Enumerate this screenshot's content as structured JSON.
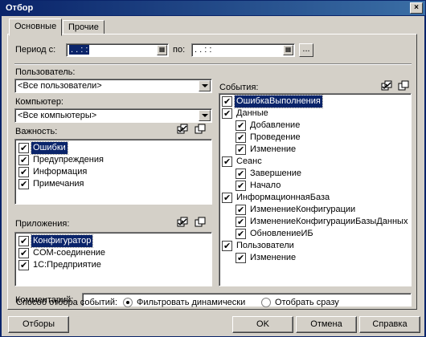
{
  "window": {
    "title": "Отбор",
    "close": "×"
  },
  "tabs": [
    {
      "label": "Основные"
    },
    {
      "label": "Прочие"
    }
  ],
  "period": {
    "label_from": "Период с:",
    "value_from": "  .  .    :  :",
    "label_to": "по:",
    "value_to": "  .  .    :  :",
    "more_button": "..."
  },
  "user": {
    "label": "Пользователь:",
    "value": "<Все пользователи>"
  },
  "computer": {
    "label": "Компьютер:",
    "value": "<Все компьютеры>"
  },
  "importance": {
    "label": "Важность:",
    "items": [
      {
        "label": "Ошибки",
        "checked": true,
        "selected": true
      },
      {
        "label": "Предупреждения",
        "checked": true
      },
      {
        "label": "Информация",
        "checked": true
      },
      {
        "label": "Примечания",
        "checked": true
      }
    ]
  },
  "applications": {
    "label": "Приложения:",
    "items": [
      {
        "label": "Конфигуратор",
        "checked": true,
        "selected": true
      },
      {
        "label": "COM-соединение",
        "checked": true
      },
      {
        "label": "1С:Предприятие",
        "checked": true
      }
    ]
  },
  "events": {
    "label": "События:",
    "items": [
      {
        "label": "ОшибкаВыполнения",
        "level": 0,
        "selected": true
      },
      {
        "label": "Данные",
        "level": 0
      },
      {
        "label": "Добавление",
        "level": 1
      },
      {
        "label": "Проведение",
        "level": 1
      },
      {
        "label": "Изменение",
        "level": 1
      },
      {
        "label": "Сеанс",
        "level": 0
      },
      {
        "label": "Завершение",
        "level": 1
      },
      {
        "label": "Начало",
        "level": 1
      },
      {
        "label": "ИнформационнаяБаза",
        "level": 0
      },
      {
        "label": "ИзменениеКонфигурации",
        "level": 1
      },
      {
        "label": "ИзменениеКонфигурацииБазыДанных",
        "level": 1
      },
      {
        "label": "ОбновлениеИБ",
        "level": 1
      },
      {
        "label": "Пользователи",
        "level": 0
      },
      {
        "label": "Изменение",
        "level": 1
      }
    ]
  },
  "comment": {
    "label": "Комментарий:",
    "value": ""
  },
  "mode": {
    "label": "Способ отбора событий:",
    "option_dynamic": "Фильтровать динамически",
    "option_now": "Отобрать сразу",
    "selected": "dynamic"
  },
  "buttons": {
    "filters": "Отборы",
    "ok": "OK",
    "cancel": "Отмена",
    "help": "Справка"
  }
}
